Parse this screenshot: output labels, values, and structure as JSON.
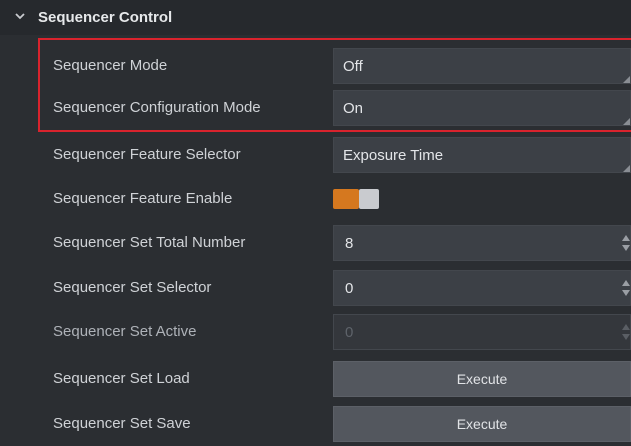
{
  "section": {
    "title": "Sequencer Control",
    "icon": "chevron-down-icon"
  },
  "rows": [
    {
      "label": "Sequencer Mode",
      "value": "Off"
    },
    {
      "label": "Sequencer Configuration Mode",
      "value": "On"
    },
    {
      "label": "Sequencer Feature Selector",
      "value": "Exposure Time"
    },
    {
      "label": "Sequencer Feature Enable",
      "value": true
    },
    {
      "label": "Sequencer Set Total Number",
      "value": "8"
    },
    {
      "label": "Sequencer Set Selector",
      "value": "0"
    },
    {
      "label": "Sequencer Set Active",
      "value": "0"
    },
    {
      "label": "Sequencer Set Load",
      "button": "Execute"
    },
    {
      "label": "Sequencer Set Save",
      "button": "Execute"
    }
  ],
  "colors": {
    "highlight": "#d9232d",
    "toggle_on": "#d5781f"
  }
}
